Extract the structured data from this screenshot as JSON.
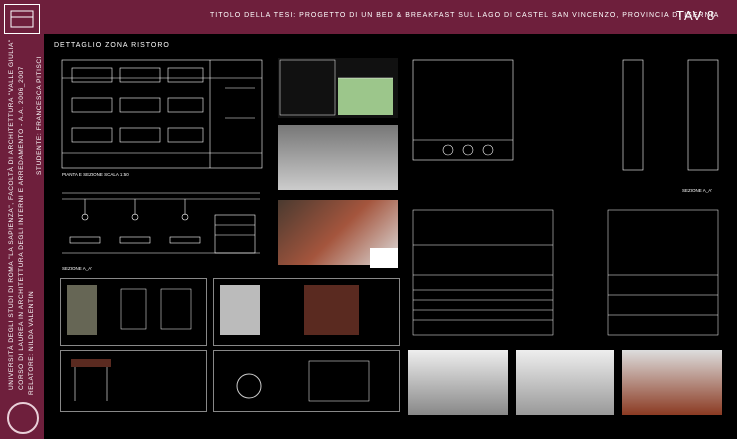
{
  "header": {
    "title": "TITOLO DELLA TESI: PROGETTO DI UN BED & BREAKFAST SUL LAGO DI CASTEL SAN VINCENZO, PROVINCIA DI ISERNIA",
    "tav": "TAV 8"
  },
  "sidebar": {
    "university": "UNIVERSITÀ DEGLI STUDI DI ROMA \"LA SAPIENZA\", FACOLTÀ DI ARCHITETTURA \"VALLE GIULIA\"",
    "course": "CORSO DI LAUREA IN ARCHITETTURA DEGLI INTERNI E ARREDAMENTO - A.A. 2006_2007",
    "relatore": "RELATORE: NILDA VALENTIN",
    "studente": "STUDENTE: FRANCESCA PITISCI"
  },
  "section": {
    "heading": "DETTAGLIO ZONA RISTORO",
    "pianta_label": "PIANTA E SEZIONE SCALA 1:50",
    "sezione_aa": "SEZIONE A_A'",
    "sezione_aa_right": "SEZIONE A_A'"
  },
  "colors": {
    "brand": "#6e1f3c",
    "background": "#000000",
    "line": "#ffffff"
  }
}
